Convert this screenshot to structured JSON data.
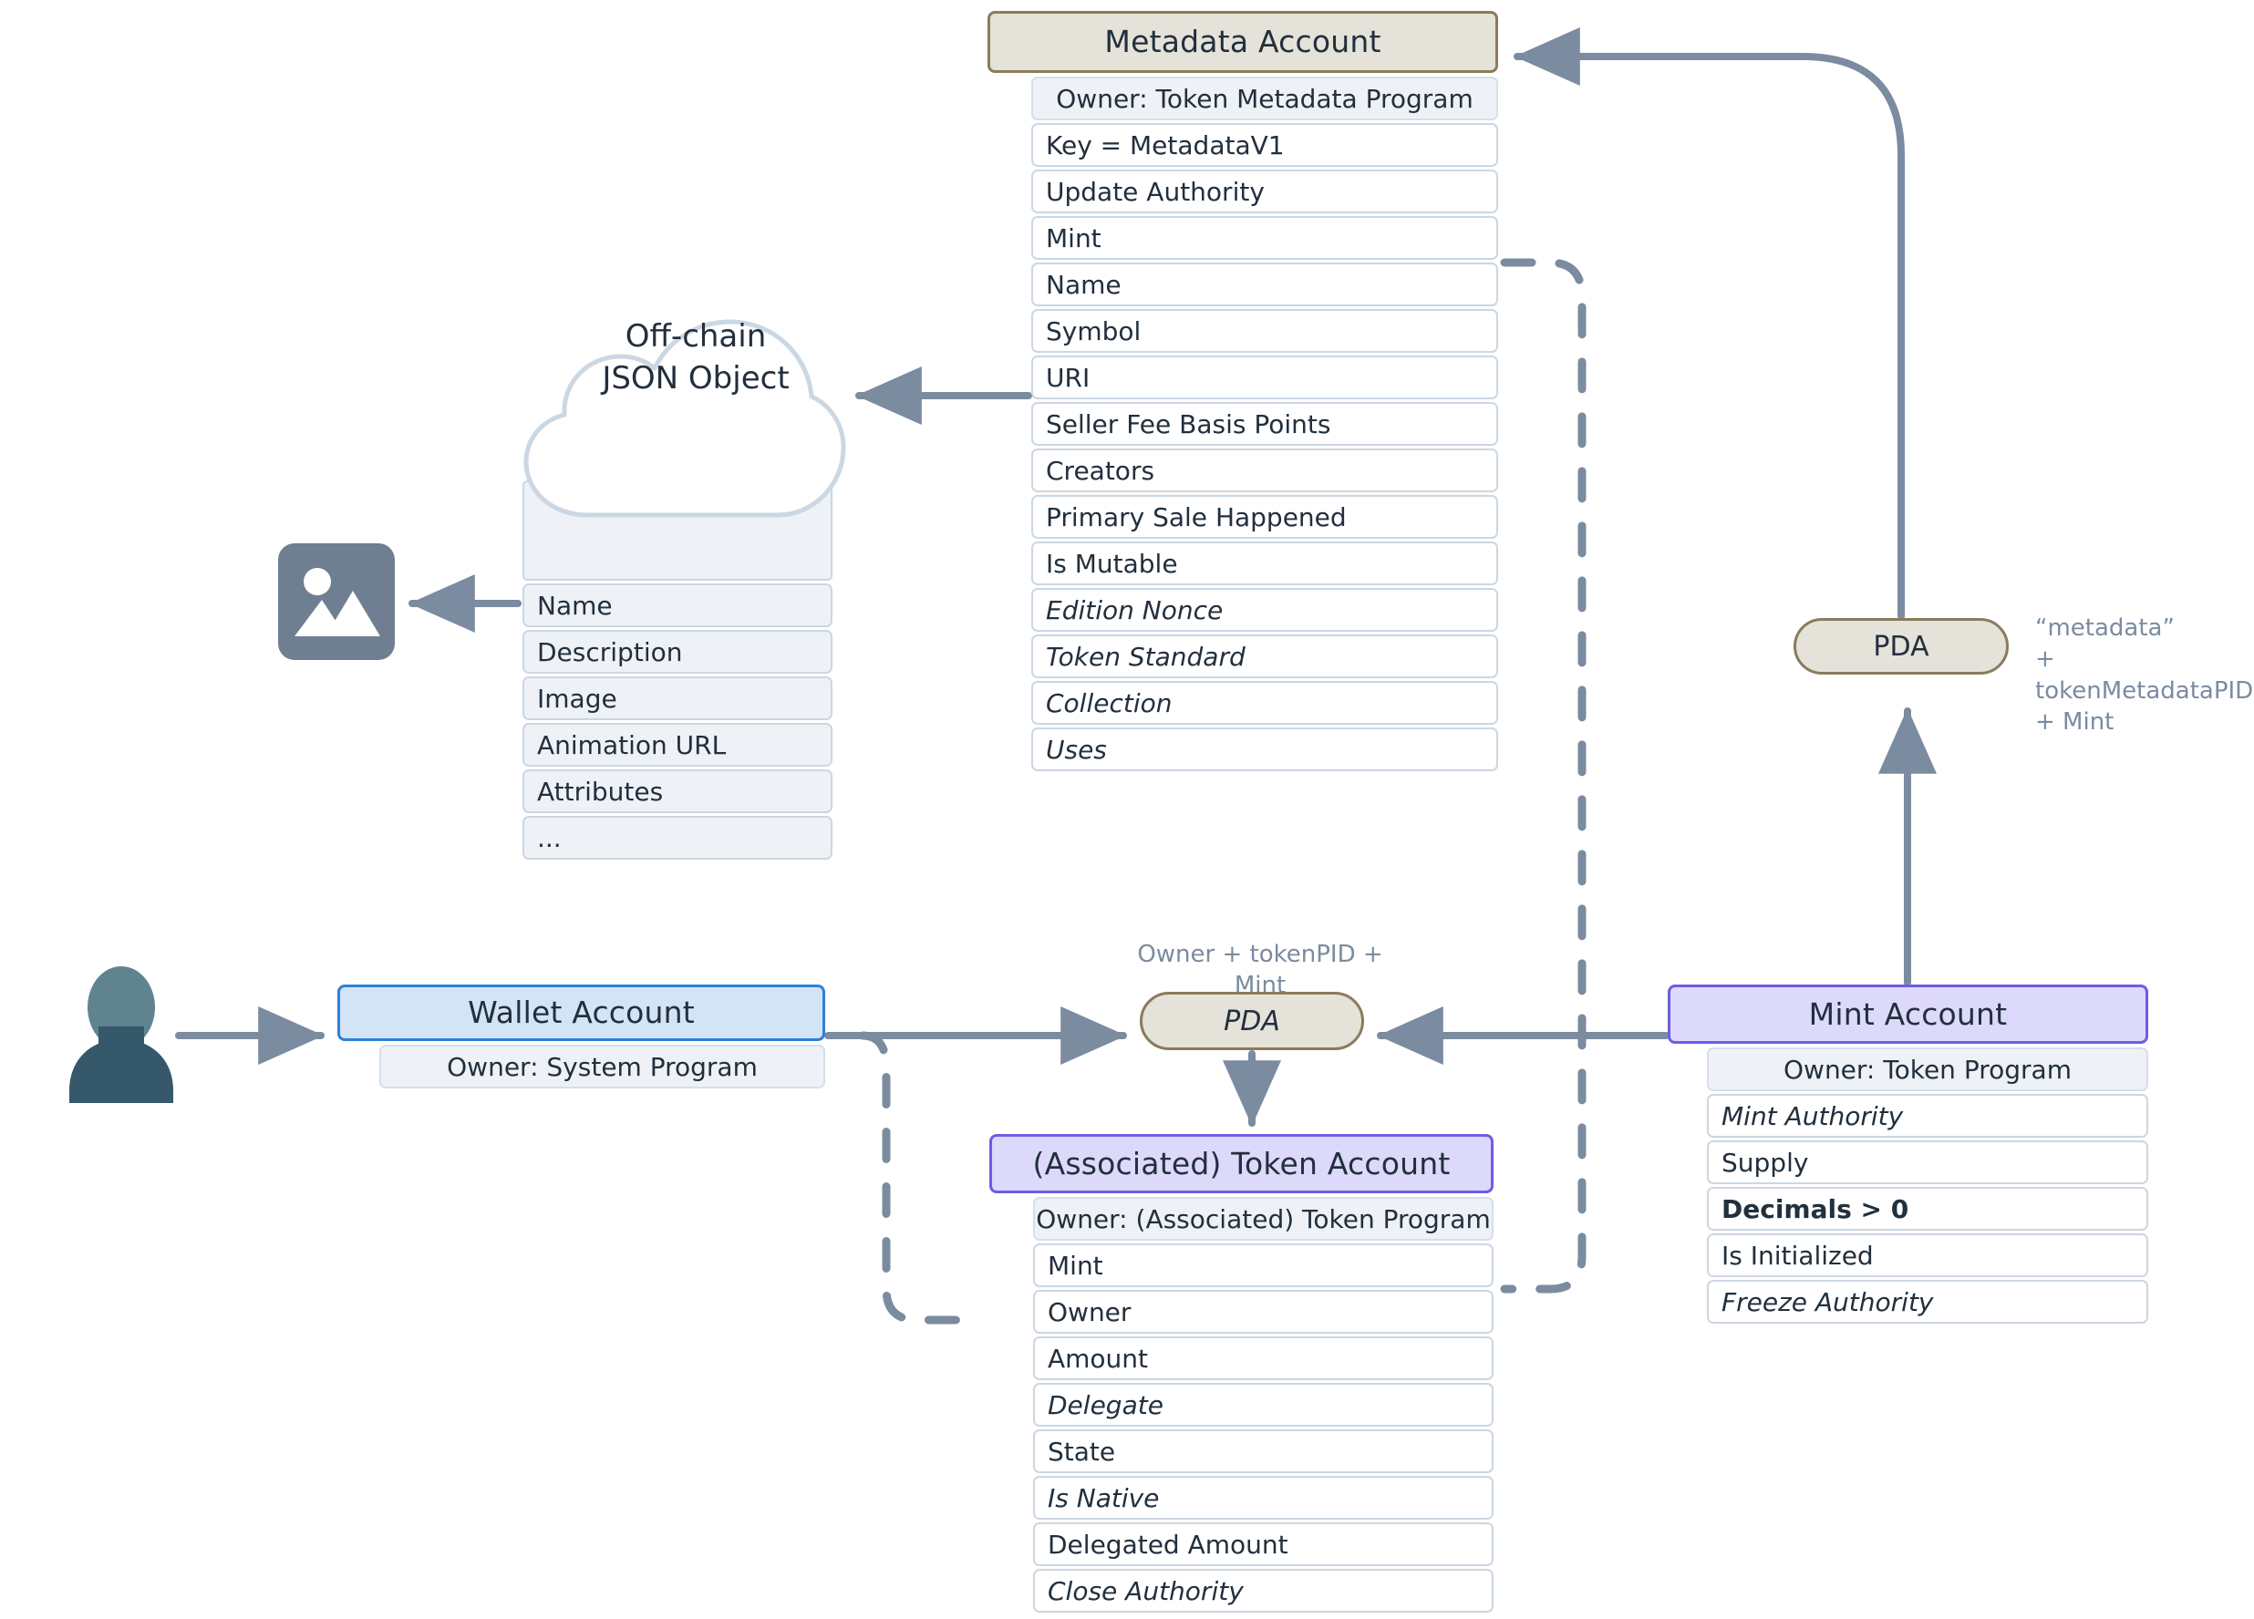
{
  "metadata_account": {
    "title": "Metadata Account",
    "owner": "Owner: Token Metadata Program",
    "fields": [
      {
        "label": "Key = MetadataV1",
        "style": "normal"
      },
      {
        "label": "Update Authority",
        "style": "normal"
      },
      {
        "label": "Mint",
        "style": "normal"
      },
      {
        "label": "Name",
        "style": "normal"
      },
      {
        "label": "Symbol",
        "style": "normal"
      },
      {
        "label": "URI",
        "style": "normal"
      },
      {
        "label": "Seller Fee Basis Points",
        "style": "normal"
      },
      {
        "label": "Creators",
        "style": "normal"
      },
      {
        "label": "Primary Sale Happened",
        "style": "normal"
      },
      {
        "label": "Is Mutable",
        "style": "normal"
      },
      {
        "label": "Edition Nonce",
        "style": "italic"
      },
      {
        "label": "Token Standard",
        "style": "italic"
      },
      {
        "label": "Collection",
        "style": "italic"
      },
      {
        "label": "Uses",
        "style": "italic"
      }
    ]
  },
  "offchain_json": {
    "title_line1": "Off-chain",
    "title_line2": "JSON Object",
    "fields": [
      {
        "label": "Name"
      },
      {
        "label": "Description"
      },
      {
        "label": "Image"
      },
      {
        "label": "Animation URL"
      },
      {
        "label": "Attributes"
      },
      {
        "label": "..."
      }
    ]
  },
  "wallet_account": {
    "title": "Wallet Account",
    "owner": "Owner: System Program",
    "fields": []
  },
  "token_account": {
    "title": "(Associated) Token Account",
    "owner": "Owner: (Associated) Token Program",
    "fields": [
      {
        "label": "Mint",
        "style": "normal"
      },
      {
        "label": "Owner",
        "style": "normal"
      },
      {
        "label": "Amount",
        "style": "normal"
      },
      {
        "label": "Delegate",
        "style": "italic"
      },
      {
        "label": "State",
        "style": "normal"
      },
      {
        "label": "Is Native",
        "style": "italic"
      },
      {
        "label": "Delegated Amount",
        "style": "normal"
      },
      {
        "label": "Close Authority",
        "style": "italic"
      }
    ]
  },
  "mint_account": {
    "title": "Mint Account",
    "owner": "Owner: Token Program",
    "fields": [
      {
        "label": "Mint Authority",
        "style": "italic"
      },
      {
        "label": "Supply",
        "style": "normal"
      },
      {
        "label": "Decimals > 0",
        "style": "bold"
      },
      {
        "label": "Is Initialized",
        "style": "normal"
      },
      {
        "label": "Freeze Authority",
        "style": "italic"
      }
    ]
  },
  "pda_token": {
    "label": "PDA",
    "seeds": "Owner + tokenPID + Mint"
  },
  "pda_metadata": {
    "label": "PDA",
    "seeds": "“metadata”\n+ tokenMetadataPID\n+ Mint"
  },
  "icons": {
    "person": "person-icon",
    "image": "image-placeholder-icon",
    "cloud": "cloud-icon"
  },
  "colors": {
    "beige_fill": "#e5e2da",
    "beige_border": "#8a7b5c",
    "purple_fill": "#ddd9fb",
    "purple_border": "#6c5ce7",
    "blue_fill": "#d4e4f7",
    "blue_border": "#2f80d8",
    "row_fill": "#eef2f6",
    "row_border": "#cbd7e2",
    "arrow": "#7b8ba0",
    "text": "#222f3d",
    "icon_gray": "#6f7f91"
  }
}
